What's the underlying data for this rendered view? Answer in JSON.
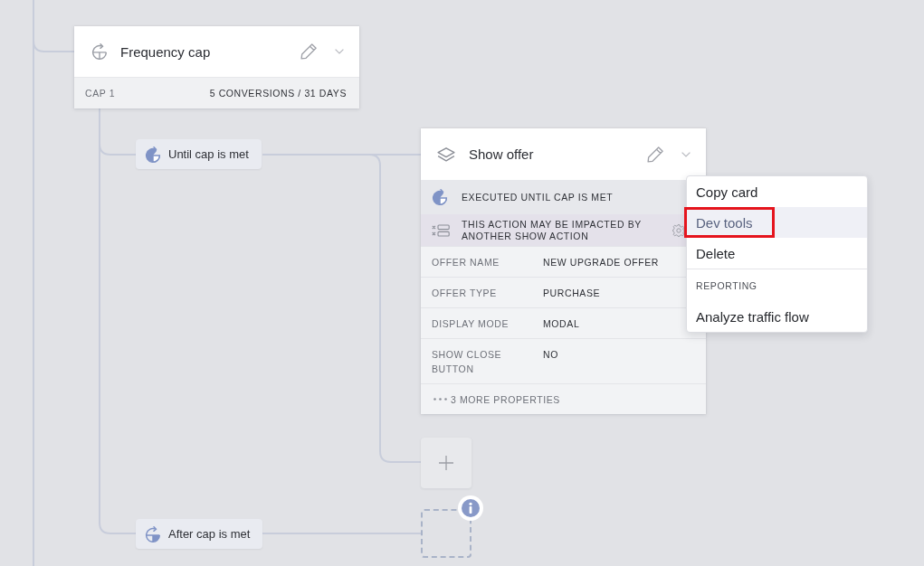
{
  "canvas": {
    "frequency_cap_card": {
      "title": "Frequency cap",
      "cap_label": "CAP 1",
      "cap_value": "5 CONVERSIONS / 31 DAYS"
    },
    "branches": [
      {
        "kind": "until",
        "label": "Until cap is met"
      },
      {
        "kind": "after",
        "label": "After cap is met"
      }
    ],
    "show_offer_card": {
      "title": "Show offer",
      "status": "EXECUTED UNTIL CAP IS MET",
      "warning": "THIS ACTION MAY BE IMPACTED BY ANOTHER SHOW ACTION",
      "properties": [
        {
          "name": "OFFER NAME",
          "value": "NEW UPGRADE OFFER"
        },
        {
          "name": "OFFER TYPE",
          "value": "PURCHASE"
        },
        {
          "name": "DISPLAY MODE",
          "value": "MODAL"
        },
        {
          "name": "SHOW CLOSE BUTTON",
          "value": "NO"
        }
      ],
      "more_properties": "3 MORE PROPERTIES"
    }
  },
  "context_menu": {
    "items": [
      {
        "kind": "action",
        "label": "Copy card",
        "selected": false,
        "highlighted": false
      },
      {
        "kind": "action",
        "label": "Dev tools",
        "selected": true,
        "highlighted": true
      },
      {
        "kind": "action",
        "label": "Delete",
        "selected": false,
        "highlighted": false
      },
      {
        "kind": "section",
        "label": "REPORTING"
      },
      {
        "kind": "action",
        "label": "Analyze traffic flow",
        "selected": false,
        "highlighted": false
      }
    ]
  }
}
